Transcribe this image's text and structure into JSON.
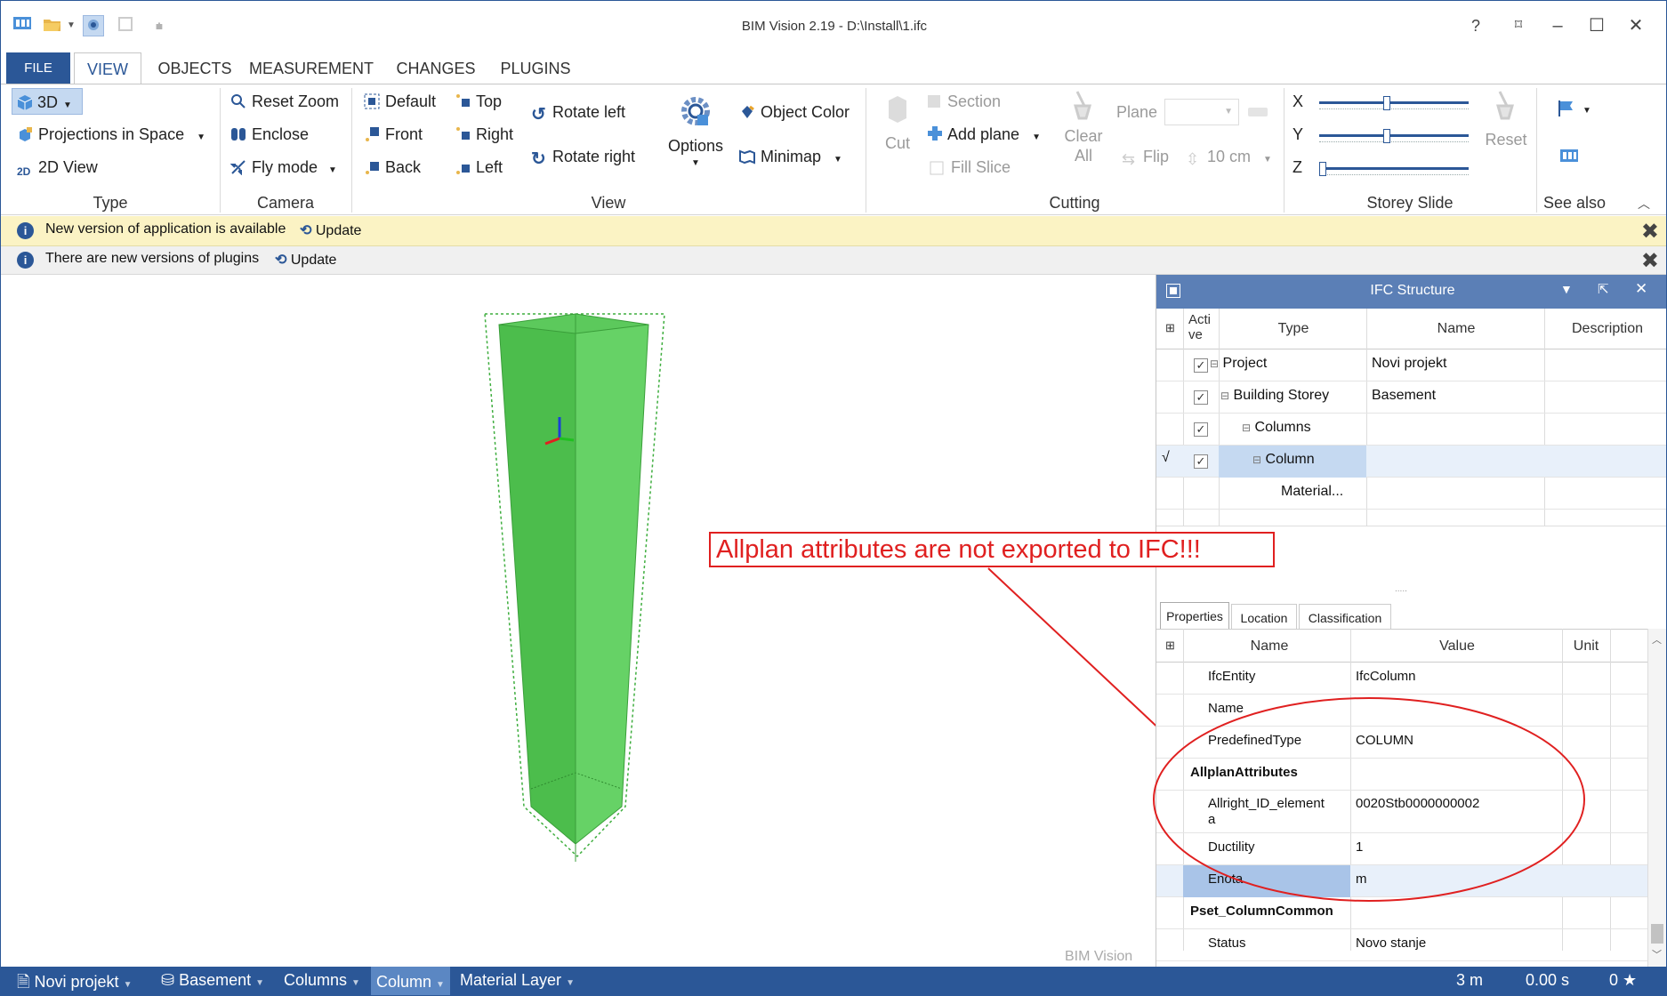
{
  "window": {
    "title": "BIM Vision 2.19 - D:\\Install\\1.ifc"
  },
  "quick_access": [
    "bim-vision-icon",
    "open-folder-icon",
    "dropdown-icon",
    "select-mode-icon",
    "disabled-icon",
    "customize-icon"
  ],
  "window_controls": {
    "help": "?",
    "restore_full": "⌑",
    "minimize": "–",
    "maximize": "☐",
    "close": "✕"
  },
  "tabs": [
    {
      "label": "FILE"
    },
    {
      "label": "VIEW",
      "active": true
    },
    {
      "label": "OBJECTS"
    },
    {
      "label": "MEASUREMENT"
    },
    {
      "label": "CHANGES"
    },
    {
      "label": "PLUGINS"
    }
  ],
  "ribbon": {
    "type": {
      "label": "Type",
      "items": [
        "3D",
        "Projections in Space",
        "2D View"
      ]
    },
    "camera": {
      "label": "Camera",
      "items": [
        "Reset Zoom",
        "Enclose",
        "Fly mode"
      ]
    },
    "view": {
      "label": "View",
      "items": [
        "Default",
        "Front",
        "Back",
        "Top",
        "Right",
        "Left",
        "Rotate left",
        "Rotate right",
        "Options",
        "Object Color",
        "Minimap"
      ]
    },
    "cutting": {
      "label": "Cutting",
      "items": [
        "Cut",
        "Section",
        "Add plane",
        "Fill Slice",
        "Clear",
        "All",
        "Plane",
        "Flip",
        "10 cm"
      ]
    },
    "storey": {
      "label": "Storey Slide",
      "axes": [
        "X",
        "Y",
        "Z"
      ],
      "reset": "Reset",
      "x_pos": 0.45,
      "y_pos": 0.45,
      "z_pos": 0.0
    },
    "seealso": {
      "label": "See also"
    }
  },
  "notifications": [
    {
      "text": "New version of application is available",
      "action": "Update"
    },
    {
      "text": "There are new versions of plugins",
      "action": "Update"
    }
  ],
  "viewport": {
    "watermark": "BIM Vision"
  },
  "annotation": {
    "text": "Allplan attributes are not exported to IFC!!!",
    "color": "#e02020"
  },
  "ifc_structure": {
    "title": "IFC Structure",
    "columns": [
      "Acti\nve",
      "Type",
      "Name",
      "Description"
    ],
    "rows": [
      {
        "type": "Project",
        "name": "Novi projekt",
        "level": 0,
        "checked": true,
        "expander": "⊟"
      },
      {
        "type": "Building Storey",
        "name": "Basement",
        "level": 1,
        "checked": true,
        "expander": "⊟"
      },
      {
        "type": "Columns",
        "name": "",
        "level": 2,
        "checked": true,
        "expander": "⊟"
      },
      {
        "type": "Column",
        "name": "",
        "level": 3,
        "checked": true,
        "expander": "⊟",
        "selected": true,
        "mark": "√"
      },
      {
        "type": "Material...",
        "name": "",
        "level": 4,
        "checked": false,
        "expander": ""
      }
    ]
  },
  "properties": {
    "tabs": [
      "Properties",
      "Location",
      "Classification"
    ],
    "columns": [
      "Name",
      "Value",
      "Unit"
    ],
    "rows": [
      {
        "name": "IfcEntity",
        "value": "IfcColumn"
      },
      {
        "name": "Name",
        "value": ""
      },
      {
        "name": "PredefinedType",
        "value": "COLUMN"
      },
      {
        "name": "AllplanAttributes",
        "value": "",
        "group": true
      },
      {
        "name": "Allright_ID_element\na",
        "value": "0020Stb0000000002"
      },
      {
        "name": "Ductility",
        "value": "1"
      },
      {
        "name": "Enota",
        "value": "m",
        "selected": true
      },
      {
        "name": "Pset_ColumnCommon",
        "value": "",
        "group": true
      },
      {
        "name": "Status",
        "value": "Novo stanje"
      }
    ]
  },
  "statusbar": {
    "crumbs": [
      "Novi projekt",
      "Basement",
      "Columns",
      "Column",
      "Material Layer"
    ],
    "distance": "3 m",
    "time": "0.00 s",
    "rating": "0 ★"
  },
  "colors": {
    "accent": "#2b5797",
    "column_fill": "#5cc95c",
    "column_dark": "#3fae3f"
  }
}
